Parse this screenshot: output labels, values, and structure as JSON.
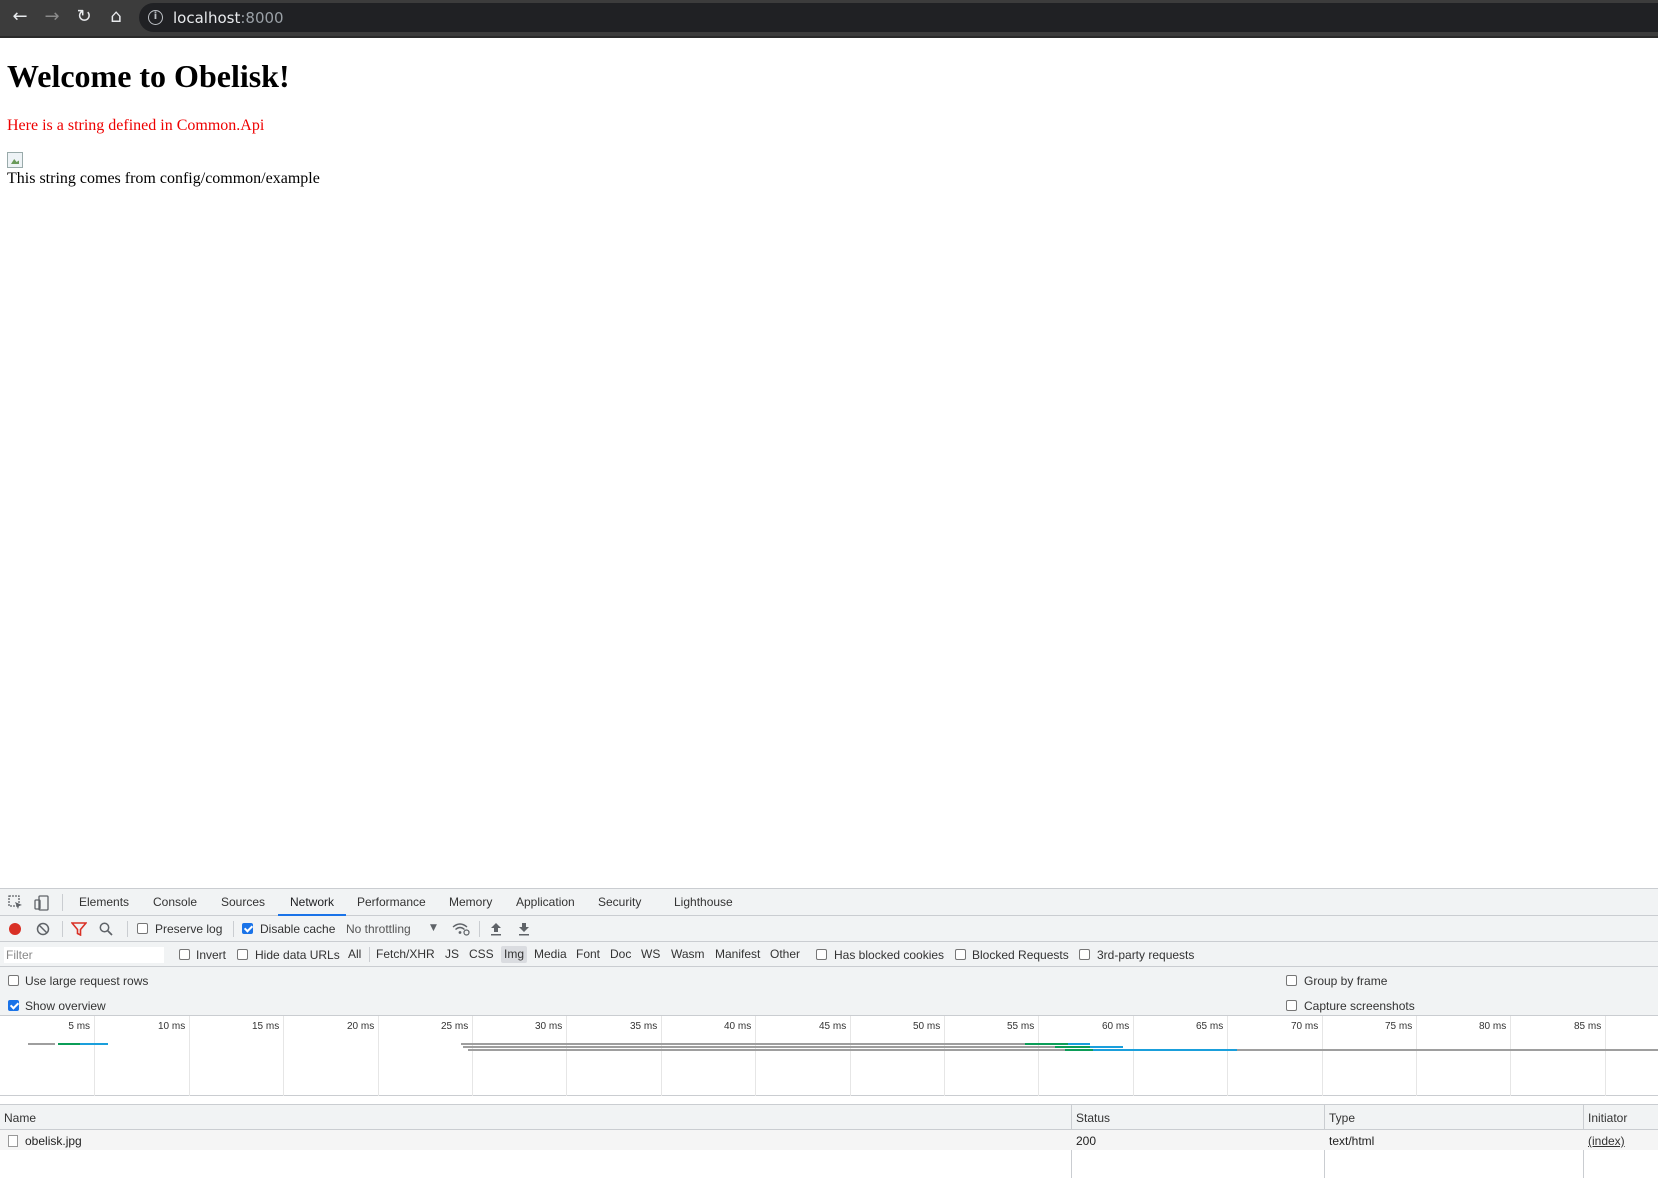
{
  "browser": {
    "url_host": "localhost",
    "url_port": ":8000",
    "back_icon": "arrow-left-icon",
    "forward_icon": "arrow-right-icon",
    "reload_icon": "reload-icon",
    "home_icon": "home-icon",
    "info_icon": "info-icon"
  },
  "page": {
    "heading": "Welcome to Obelisk!",
    "common_api_text": "Here is a string defined in Common.Api",
    "config_text": "This string comes from config/common/example",
    "common_api_color": "#ee0000"
  },
  "devtools": {
    "tabs": [
      "Elements",
      "Console",
      "Sources",
      "Network",
      "Performance",
      "Memory",
      "Application",
      "Security",
      "Lighthouse"
    ],
    "active_tab": "Network",
    "toolbar": {
      "preserve_log": "Preserve log",
      "preserve_log_checked": false,
      "disable_cache": "Disable cache",
      "disable_cache_checked": true,
      "throttling": "No throttling"
    },
    "filter": {
      "placeholder": "Filter",
      "invert": "Invert",
      "hide_data_urls": "Hide data URLs",
      "types": [
        "All",
        "Fetch/XHR",
        "JS",
        "CSS",
        "Img",
        "Media",
        "Font",
        "Doc",
        "WS",
        "Wasm",
        "Manifest",
        "Other"
      ],
      "selected_type": "Img",
      "has_blocked_cookies": "Has blocked cookies",
      "blocked_requests": "Blocked Requests",
      "third_party": "3rd-party requests"
    },
    "options": {
      "large_rows": "Use large request rows",
      "show_overview": "Show overview",
      "group_by_frame": "Group by frame",
      "capture_screenshots": "Capture screenshots"
    },
    "timeline_ticks": [
      "5 ms",
      "10 ms",
      "15 ms",
      "20 ms",
      "25 ms",
      "30 ms",
      "35 ms",
      "40 ms",
      "45 ms",
      "50 ms",
      "55 ms",
      "60 ms",
      "65 ms",
      "70 ms",
      "75 ms",
      "80 ms",
      "85 ms"
    ],
    "table": {
      "headers": [
        "Name",
        "Status",
        "Type",
        "Initiator"
      ],
      "rows": [
        {
          "name": "obelisk.jpg",
          "status": "200",
          "type": "text/html",
          "initiator": "(index)"
        }
      ]
    }
  }
}
